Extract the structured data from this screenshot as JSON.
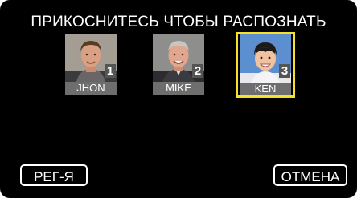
{
  "screen": {
    "title": "ПРИКОСНИТЕСЬ ЧТОБЫ РАСПОЗНАТЬ"
  },
  "faces": [
    {
      "name": "JHON",
      "number": "1",
      "selected": false
    },
    {
      "name": "MIKE",
      "number": "2",
      "selected": false
    },
    {
      "name": "KEN",
      "number": "3",
      "selected": true
    }
  ],
  "buttons": {
    "register_label": "РЕГ-Я",
    "cancel_label": "ОТМЕНА"
  },
  "colors": {
    "background": "#000000",
    "selection": "#f5e12a",
    "name_bar": "#6e6e6e"
  }
}
